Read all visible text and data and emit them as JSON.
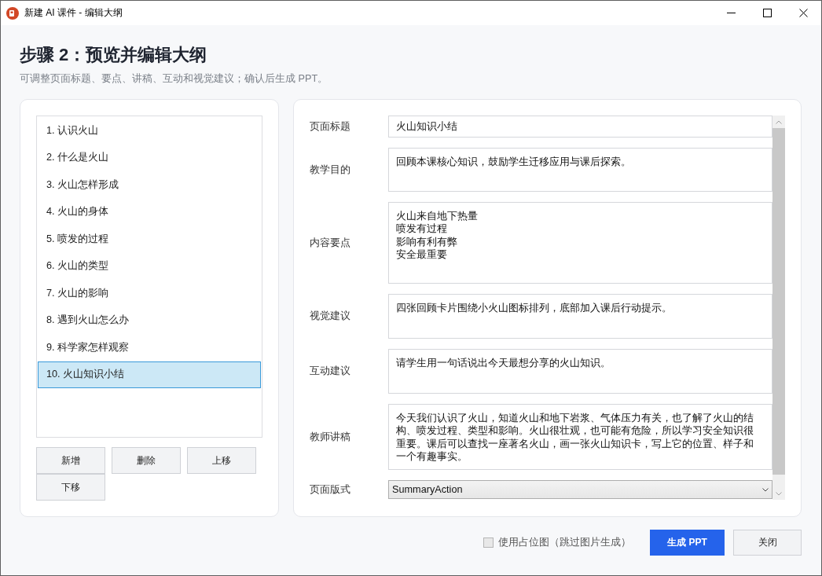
{
  "window": {
    "title": "新建 AI 课件 - 编辑大纲"
  },
  "header": {
    "title": "步骤 2：预览并编辑大纲",
    "subtitle": "可调整页面标题、要点、讲稿、互动和视觉建议；确认后生成 PPT。"
  },
  "outline": {
    "items": [
      {
        "label": "1. 认识火山",
        "selected": false
      },
      {
        "label": "2. 什么是火山",
        "selected": false
      },
      {
        "label": "3. 火山怎样形成",
        "selected": false
      },
      {
        "label": "4. 火山的身体",
        "selected": false
      },
      {
        "label": "5. 喷发的过程",
        "selected": false
      },
      {
        "label": "6. 火山的类型",
        "selected": false
      },
      {
        "label": "7. 火山的影响",
        "selected": false
      },
      {
        "label": "8. 遇到火山怎么办",
        "selected": false
      },
      {
        "label": "9. 科学家怎样观察",
        "selected": false
      },
      {
        "label": "10. 火山知识小结",
        "selected": true
      }
    ],
    "buttons": [
      "新增",
      "删除",
      "上移",
      "下移"
    ]
  },
  "editor": {
    "fields": [
      {
        "label": "页面标题",
        "kind": "input",
        "value": "火山知识小结"
      },
      {
        "label": "教学目的",
        "kind": "textarea",
        "value": "回顾本课核心知识，鼓励学生迁移应用与课后探索。"
      },
      {
        "label": "内容要点",
        "kind": "lines",
        "lines": [
          "火山来自地下热量",
          "喷发有过程",
          "影响有利有弊",
          "安全最重要"
        ]
      },
      {
        "label": "视觉建议",
        "kind": "textarea",
        "value": "四张回顾卡片围绕小火山图标排列，底部加入课后行动提示。"
      },
      {
        "label": "互动建议",
        "kind": "textarea",
        "value": "请学生用一句话说出今天最想分享的火山知识。"
      },
      {
        "label": "教师讲稿",
        "kind": "textarea",
        "value": "今天我们认识了火山，知道火山和地下岩浆、气体压力有关，也了解了火山的结构、喷发过程、类型和影响。火山很壮观，也可能有危险，所以学习安全知识很重要。课后可以查找一座著名火山，画一张火山知识卡，写上它的位置、样子和一个有趣事实。"
      },
      {
        "label": "页面版式",
        "kind": "select",
        "value": "SummaryAction"
      }
    ]
  },
  "footer": {
    "placeholder_option": {
      "label": "使用占位图（跳过图片生成）",
      "checked": false
    },
    "buttons": [
      {
        "label": "生成 PPT",
        "kind": "primary"
      },
      {
        "label": "关闭",
        "kind": "secondary"
      }
    ]
  }
}
